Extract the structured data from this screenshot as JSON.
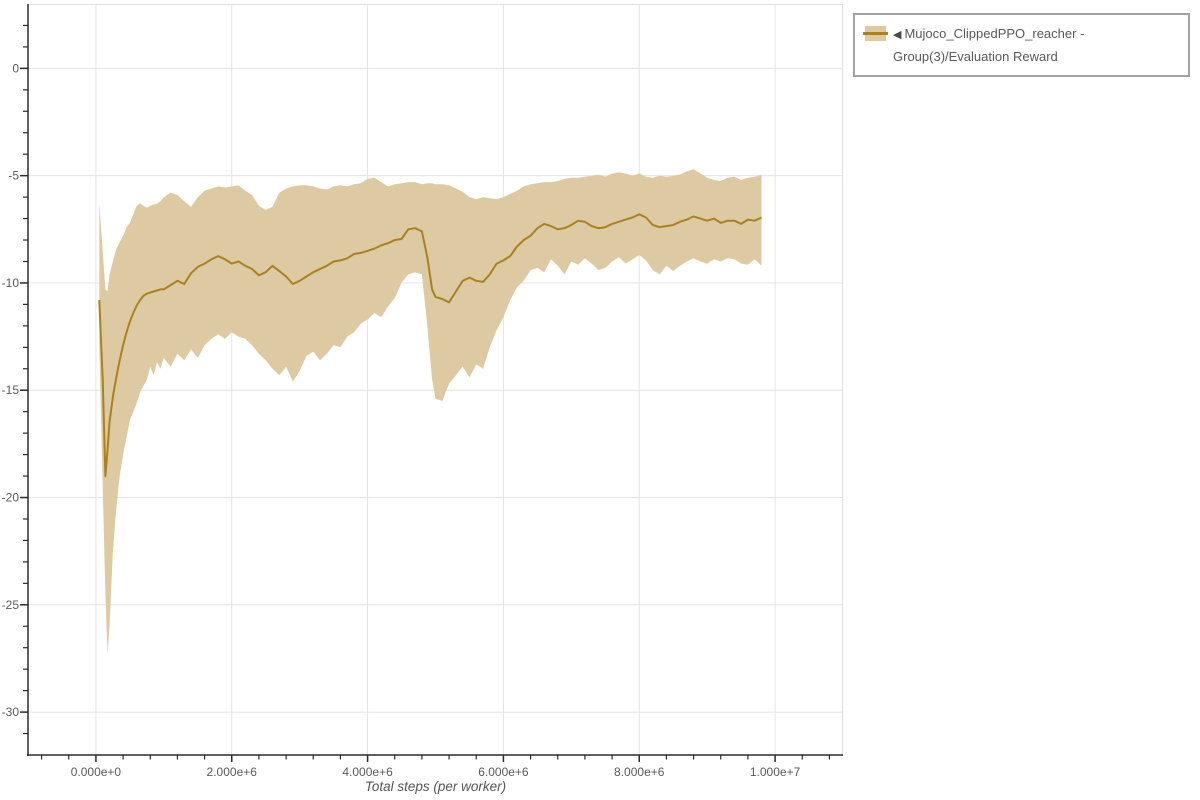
{
  "legend": {
    "collapse_arrow": "◀",
    "series_label": "Mujoco_ClippedPPO_reacher - Group(3)/Evaluation Reward"
  },
  "axes": {
    "x_title": "Total steps (per worker)"
  },
  "colors": {
    "line": "#a9811f",
    "band": "#decaa2",
    "grid": "#e4e4e4",
    "plot_border": "#e0e0e0",
    "axis": "#2b2b2b",
    "tick_text": "#5a5a5a",
    "legend_border": "#a2a2a2",
    "legend_text": "#595959"
  },
  "chart_data": {
    "type": "line",
    "title": "",
    "xlabel": "Total steps (per worker)",
    "ylabel": "",
    "legend_position": "top-right-outside",
    "grid": true,
    "series": [
      {
        "name": "Mujoco_ClippedPPO_reacher - Group(3)/Evaluation Reward",
        "style": "mean line with shaded min-max band"
      }
    ],
    "x_unit": "millions of steps",
    "xlim": [
      -1,
      11
    ],
    "ylim": [
      -32,
      3
    ],
    "x_ticks": [
      {
        "value": 0,
        "label": "0.000e+0"
      },
      {
        "value": 2,
        "label": "2.000e+6"
      },
      {
        "value": 4,
        "label": "4.000e+6"
      },
      {
        "value": 6,
        "label": "6.000e+6"
      },
      {
        "value": 8,
        "label": "8.000e+6"
      },
      {
        "value": 10,
        "label": "1.000e+7"
      }
    ],
    "y_ticks": [
      {
        "value": 0,
        "label": "0"
      },
      {
        "value": -5,
        "label": "-5"
      },
      {
        "value": -10,
        "label": "-10"
      },
      {
        "value": -15,
        "label": "-15"
      },
      {
        "value": -20,
        "label": "-20"
      },
      {
        "value": -25,
        "label": "-25"
      },
      {
        "value": -30,
        "label": "-30"
      }
    ],
    "x_minor_step": 0.4,
    "y_minor_step": 1,
    "points_format": [
      "x_millions",
      "mean",
      "band_lower",
      "band_upper"
    ],
    "points": [
      [
        0.05,
        -10.8,
        -13.0,
        -6.3
      ],
      [
        0.1,
        -14.5,
        -19.5,
        -8.5
      ],
      [
        0.14,
        -19.0,
        -24.5,
        -10.3
      ],
      [
        0.17,
        -17.8,
        -27.3,
        -10.4
      ],
      [
        0.2,
        -16.5,
        -26.0,
        -9.6
      ],
      [
        0.25,
        -15.3,
        -22.5,
        -9.0
      ],
      [
        0.3,
        -14.4,
        -20.5,
        -8.4
      ],
      [
        0.35,
        -13.6,
        -19.0,
        -8.1
      ],
      [
        0.4,
        -12.9,
        -18.0,
        -7.8
      ],
      [
        0.45,
        -12.3,
        -17.2,
        -7.4
      ],
      [
        0.5,
        -11.8,
        -16.4,
        -7.2
      ],
      [
        0.55,
        -11.4,
        -16.0,
        -6.8
      ],
      [
        0.6,
        -11.05,
        -15.6,
        -6.4
      ],
      [
        0.65,
        -10.8,
        -15.1,
        -6.3
      ],
      [
        0.7,
        -10.6,
        -14.8,
        -6.4
      ],
      [
        0.75,
        -10.5,
        -14.5,
        -6.5
      ],
      [
        0.8,
        -10.45,
        -13.9,
        -6.4
      ],
      [
        0.85,
        -10.4,
        -14.3,
        -6.35
      ],
      [
        0.9,
        -10.35,
        -13.7,
        -6.3
      ],
      [
        0.95,
        -10.3,
        -14.0,
        -6.2
      ],
      [
        1.0,
        -10.3,
        -13.5,
        -6.0
      ],
      [
        1.1,
        -10.1,
        -13.9,
        -5.8
      ],
      [
        1.2,
        -9.9,
        -13.3,
        -5.9
      ],
      [
        1.3,
        -10.05,
        -13.6,
        -6.2
      ],
      [
        1.4,
        -9.55,
        -13.1,
        -6.45
      ],
      [
        1.5,
        -9.25,
        -13.5,
        -6.0
      ],
      [
        1.6,
        -9.1,
        -12.9,
        -5.7
      ],
      [
        1.7,
        -8.9,
        -12.6,
        -5.6
      ],
      [
        1.8,
        -8.75,
        -12.4,
        -5.5
      ],
      [
        1.9,
        -8.9,
        -12.6,
        -5.55
      ],
      [
        2.0,
        -9.1,
        -12.3,
        -5.5
      ],
      [
        2.1,
        -9.0,
        -12.5,
        -5.45
      ],
      [
        2.2,
        -9.2,
        -12.6,
        -5.7
      ],
      [
        2.3,
        -9.35,
        -12.9,
        -5.9
      ],
      [
        2.4,
        -9.65,
        -13.3,
        -6.4
      ],
      [
        2.5,
        -9.5,
        -13.6,
        -6.6
      ],
      [
        2.6,
        -9.2,
        -14.0,
        -6.45
      ],
      [
        2.7,
        -9.45,
        -14.3,
        -5.8
      ],
      [
        2.8,
        -9.7,
        -13.9,
        -5.6
      ],
      [
        2.9,
        -10.05,
        -14.6,
        -5.5
      ],
      [
        3.0,
        -9.9,
        -14.1,
        -5.45
      ],
      [
        3.1,
        -9.7,
        -13.4,
        -5.45
      ],
      [
        3.2,
        -9.5,
        -13.2,
        -5.5
      ],
      [
        3.3,
        -9.35,
        -13.6,
        -5.6
      ],
      [
        3.4,
        -9.2,
        -13.3,
        -5.65
      ],
      [
        3.5,
        -9.0,
        -12.9,
        -5.5
      ],
      [
        3.6,
        -8.95,
        -13.0,
        -5.45
      ],
      [
        3.7,
        -8.85,
        -12.5,
        -5.5
      ],
      [
        3.8,
        -8.65,
        -12.3,
        -5.4
      ],
      [
        3.9,
        -8.6,
        -11.9,
        -5.35
      ],
      [
        4.0,
        -8.5,
        -11.7,
        -5.15
      ],
      [
        4.1,
        -8.4,
        -11.4,
        -5.1
      ],
      [
        4.2,
        -8.25,
        -11.6,
        -5.3
      ],
      [
        4.3,
        -8.15,
        -11.1,
        -5.5
      ],
      [
        4.4,
        -8.0,
        -10.7,
        -5.4
      ],
      [
        4.5,
        -7.95,
        -10.0,
        -5.35
      ],
      [
        4.6,
        -7.5,
        -9.6,
        -5.3
      ],
      [
        4.7,
        -7.45,
        -9.5,
        -5.3
      ],
      [
        4.8,
        -7.6,
        -9.6,
        -5.4
      ],
      [
        4.88,
        -8.8,
        -12.0,
        -5.35
      ],
      [
        4.95,
        -10.3,
        -14.5,
        -5.35
      ],
      [
        5.0,
        -10.65,
        -15.4,
        -5.4
      ],
      [
        5.1,
        -10.75,
        -15.5,
        -5.4
      ],
      [
        5.2,
        -10.9,
        -14.7,
        -5.45
      ],
      [
        5.3,
        -10.4,
        -14.3,
        -5.6
      ],
      [
        5.4,
        -9.9,
        -13.9,
        -5.75
      ],
      [
        5.5,
        -9.75,
        -14.4,
        -6.0
      ],
      [
        5.6,
        -9.9,
        -13.8,
        -6.1
      ],
      [
        5.7,
        -9.95,
        -14.0,
        -6.0
      ],
      [
        5.8,
        -9.6,
        -13.0,
        -6.05
      ],
      [
        5.9,
        -9.1,
        -12.2,
        -6.1
      ],
      [
        6.0,
        -8.95,
        -11.6,
        -6.0
      ],
      [
        6.1,
        -8.75,
        -10.8,
        -5.85
      ],
      [
        6.2,
        -8.3,
        -10.2,
        -5.7
      ],
      [
        6.3,
        -8.0,
        -9.9,
        -5.5
      ],
      [
        6.4,
        -7.8,
        -9.4,
        -5.4
      ],
      [
        6.5,
        -7.45,
        -9.3,
        -5.35
      ],
      [
        6.6,
        -7.25,
        -9.5,
        -5.3
      ],
      [
        6.7,
        -7.35,
        -8.9,
        -5.3
      ],
      [
        6.8,
        -7.5,
        -9.2,
        -5.25
      ],
      [
        6.9,
        -7.45,
        -9.6,
        -5.15
      ],
      [
        7.0,
        -7.3,
        -9.0,
        -5.1
      ],
      [
        7.1,
        -7.1,
        -9.15,
        -5.1
      ],
      [
        7.2,
        -7.15,
        -8.85,
        -5.05
      ],
      [
        7.3,
        -7.35,
        -9.1,
        -5.0
      ],
      [
        7.4,
        -7.45,
        -9.4,
        -4.95
      ],
      [
        7.5,
        -7.4,
        -9.3,
        -5.05
      ],
      [
        7.6,
        -7.25,
        -9.0,
        -4.9
      ],
      [
        7.7,
        -7.15,
        -8.8,
        -4.85
      ],
      [
        7.8,
        -7.05,
        -9.1,
        -4.9
      ],
      [
        7.9,
        -6.95,
        -8.9,
        -5.0
      ],
      [
        8.0,
        -6.8,
        -8.7,
        -4.9
      ],
      [
        8.1,
        -6.95,
        -8.95,
        -5.05
      ],
      [
        8.2,
        -7.3,
        -9.4,
        -5.1
      ],
      [
        8.3,
        -7.4,
        -9.6,
        -5.0
      ],
      [
        8.4,
        -7.35,
        -9.2,
        -5.05
      ],
      [
        8.5,
        -7.3,
        -9.45,
        -5.0
      ],
      [
        8.6,
        -7.15,
        -9.2,
        -4.95
      ],
      [
        8.7,
        -7.05,
        -9.0,
        -4.8
      ],
      [
        8.8,
        -6.9,
        -8.85,
        -4.7
      ],
      [
        8.9,
        -7.0,
        -9.0,
        -4.9
      ],
      [
        9.0,
        -7.1,
        -9.1,
        -5.1
      ],
      [
        9.1,
        -7.0,
        -8.9,
        -5.2
      ],
      [
        9.2,
        -7.2,
        -9.0,
        -5.25
      ],
      [
        9.3,
        -7.1,
        -8.85,
        -5.1
      ],
      [
        9.4,
        -7.1,
        -8.9,
        -5.05
      ],
      [
        9.5,
        -7.25,
        -9.1,
        -5.2
      ],
      [
        9.6,
        -7.05,
        -9.15,
        -5.1
      ],
      [
        9.7,
        -7.1,
        -8.9,
        -5.05
      ],
      [
        9.8,
        -6.95,
        -9.2,
        -4.95
      ]
    ]
  }
}
